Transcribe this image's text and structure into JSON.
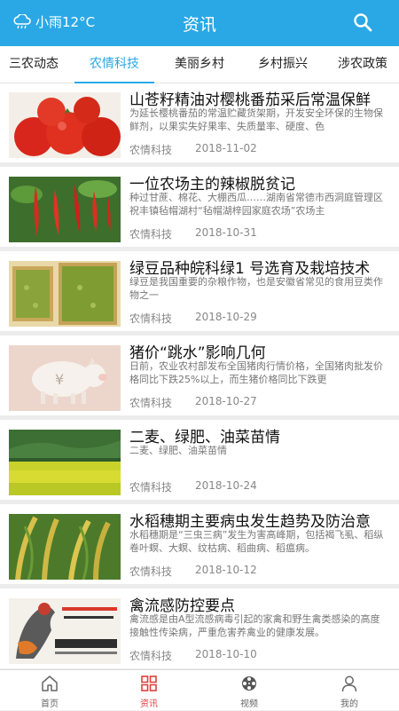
{
  "header": {
    "weather": "小雨12°C",
    "title": "资讯"
  },
  "tabs": [
    {
      "label": "三农动态"
    },
    {
      "label": "农情科技"
    },
    {
      "label": "美丽乡村"
    },
    {
      "label": "乡村振兴"
    },
    {
      "label": "涉农政策"
    }
  ],
  "articles": [
    {
      "title": "山苍籽精油对樱桃番茄采后常温保鲜",
      "desc": "为延长樱桃番茄的常温贮藏货架期，开发安全环保的生物保鲜剂，以果实失好果率、失质量率、硬度、色",
      "category": "农情科技",
      "date": "2018-11-02"
    },
    {
      "title": "一位农场主的辣椒脱贫记",
      "desc": "种过甘蔗、棉花、大棚西瓜……湖南省常德市西洞庭管理区祝丰镇毡帽湖村“毡帽湖梓园家庭农场”农场主",
      "category": "农情科技",
      "date": "2018-10-31"
    },
    {
      "title": "绿豆品种皖科绿1 号选育及栽培技术",
      "desc": "绿豆是我国重要的杂粮作物，也是安徽省常见的食用豆类作物之一",
      "category": "农情科技",
      "date": "2018-10-29"
    },
    {
      "title": "猪价“跳水”影响几何",
      "desc": "日前，农业农村部发布全国猪肉行情价格，全国猪肉批发价格同比下跌25%以上，而生猪价格同比下跌更",
      "category": "农情科技",
      "date": "2018-10-27"
    },
    {
      "title": "二麦、绿肥、油菜苗情",
      "desc": "二麦、绿肥、油菜苗情",
      "category": "农情科技",
      "date": "2018-10-24"
    },
    {
      "title": "水稻穗期主要病虫发生趋势及防治意",
      "desc": "水稻穗期是“三虫三病”发生为害高峰期，包括褐飞虱、稻纵卷叶螟、大螟、纹枯病、稻曲病、稻瘟病。",
      "category": "农情科技",
      "date": "2018-10-12"
    },
    {
      "title": "禽流感防控要点",
      "desc": "禽流感是由A型流感病毒引起的家禽和野生禽类感染的高度接触性传染病，严重危害养禽业的健康发展。",
      "category": "农情科技",
      "date": "2018-10-10"
    }
  ],
  "bottom_nav": [
    {
      "label": "首页"
    },
    {
      "label": "资讯"
    },
    {
      "label": "视频"
    },
    {
      "label": "我的"
    }
  ],
  "colors": {
    "primary": "#2aa8e6",
    "active_nav": "#e04040"
  }
}
